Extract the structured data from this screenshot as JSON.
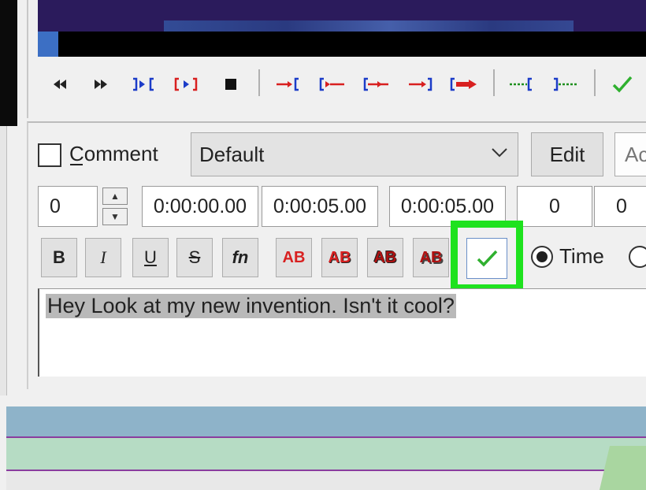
{
  "colors": {
    "highlight": "#1ee21e",
    "checkmark": "#2fb02f",
    "waveform_bg": "#2b1b5c",
    "timeline_blue": "#8eb3c9",
    "timeline_green": "#b6dcc4",
    "red_icon": "#d82020",
    "blue_icon": "#1c3cc8",
    "green_icon": "#1f8f1f"
  },
  "toolbar": {
    "icons": [
      "rewind-icon",
      "forward-icon",
      "play-selection-icon",
      "play-selection-red-icon",
      "stop-icon",
      "play-before-start-icon",
      "play-after-start-icon",
      "play-before-end-icon",
      "play-after-end-icon",
      "play-to-end-icon",
      "set-start-icon",
      "set-end-icon",
      "commit-checkmark-icon"
    ]
  },
  "editor": {
    "comment_label": "Comment",
    "style_value": "Default",
    "edit_label": "Edit",
    "actor_placeholder": "Ac",
    "layer": "0",
    "start_time": "0:00:00.00",
    "end_time": "0:00:05.00",
    "duration": "0:00:05.00",
    "margin_left": "0",
    "margin_right": "0",
    "bold_label": "B",
    "italic_label": "I",
    "underline_label": "U",
    "strike_label": "S",
    "fn_label": "fn",
    "color1_label": "AB",
    "color2_label": "AB",
    "color3_label": "AB",
    "color4_label": "AB",
    "time_label": "Time",
    "subtitle_text": "Hey Look at my new invention. Isn't it cool?"
  }
}
